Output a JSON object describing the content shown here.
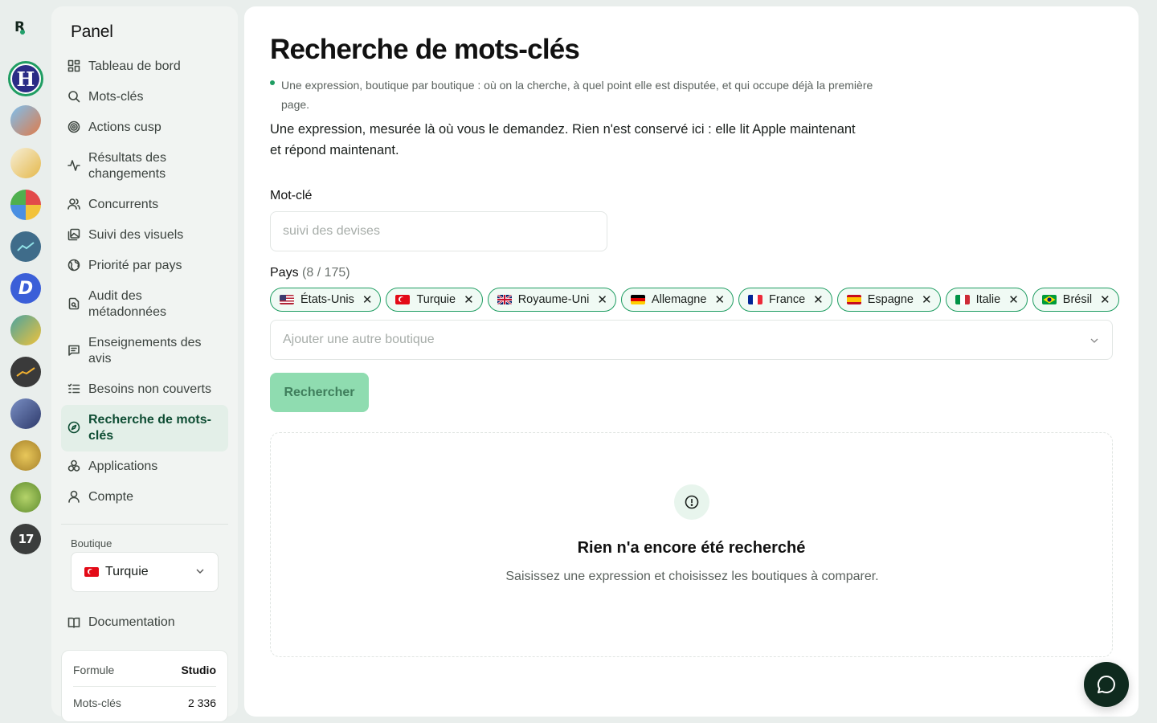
{
  "rail": {
    "logo_text": "R",
    "apps": [
      {
        "name": "app-avatar-h",
        "letter": "H",
        "active": true
      },
      {
        "name": "app-avatar-2",
        "color": "#5b9ad6"
      },
      {
        "name": "app-avatar-3",
        "color": "#e7c56a"
      },
      {
        "name": "app-avatar-4",
        "color": "#d94d4d"
      },
      {
        "name": "app-avatar-5",
        "color": "#3f6c8a"
      },
      {
        "name": "app-avatar-6",
        "color": "#3b5fd8"
      },
      {
        "name": "app-avatar-7",
        "color": "#4aa3a0"
      },
      {
        "name": "app-avatar-8",
        "color": "#3a3a3a"
      },
      {
        "name": "app-avatar-9",
        "color": "#3d5a99"
      },
      {
        "name": "app-avatar-10",
        "color": "#c9a53c"
      },
      {
        "name": "app-avatar-11",
        "color": "#6b9b3f"
      },
      {
        "name": "app-avatar-12",
        "color": "#3b3d3c"
      }
    ]
  },
  "sidebar": {
    "title": "Panel",
    "items": [
      {
        "label": "Tableau de bord",
        "icon": "dashboard-icon"
      },
      {
        "label": "Mots-clés",
        "icon": "search-icon"
      },
      {
        "label": "Actions cusp",
        "icon": "target-icon"
      },
      {
        "label": "Résultats des changements",
        "icon": "activity-icon"
      },
      {
        "label": "Concurrents",
        "icon": "users-icon"
      },
      {
        "label": "Suivi des visuels",
        "icon": "images-icon"
      },
      {
        "label": "Priorité par pays",
        "icon": "globe-icon"
      },
      {
        "label": "Audit des métadonnées",
        "icon": "file-search-icon"
      },
      {
        "label": "Enseignements des avis",
        "icon": "message-icon"
      },
      {
        "label": "Besoins non couverts",
        "icon": "list-check-icon"
      },
      {
        "label": "Recherche de mots-clés",
        "icon": "compass-icon",
        "active": true
      },
      {
        "label": "Applications",
        "icon": "apps-icon"
      },
      {
        "label": "Compte",
        "icon": "user-icon"
      }
    ],
    "store_label": "Boutique",
    "store_value": "Turquie",
    "documentation": "Documentation",
    "plan": {
      "label": "Formule",
      "value": "Studio",
      "keywords_label": "Mots-clés",
      "keywords_value": "2 336"
    }
  },
  "main": {
    "title": "Recherche de mots-clés",
    "subtitle": "Une expression, boutique par boutique : où on la cherche, à quel point elle est disputée, et qui occupe déjà la première page.",
    "lead": "Une expression, mesurée là où vous le demandez. Rien n'est conservé ici : elle lit Apple maintenant et répond maintenant.",
    "keyword_label": "Mot-clé",
    "keyword_placeholder": "suivi des devises",
    "keyword_value": "",
    "country_label": "Pays",
    "country_count": "(8 / 175)",
    "countries": [
      "États-Unis",
      "Turquie",
      "Royaume-Uni",
      "Allemagne",
      "France",
      "Espagne",
      "Italie",
      "Brésil"
    ],
    "add_store_placeholder": "Ajouter une autre boutique",
    "search_button": "Rechercher",
    "empty_title": "Rien n'a encore été recherché",
    "empty_text": "Saisissez une expression et choisissez les boutiques à comparer."
  },
  "colors": {
    "accent": "#1f9d62",
    "button_disabled": "#8fdcb0",
    "chat_button": "#0f2a1e"
  }
}
